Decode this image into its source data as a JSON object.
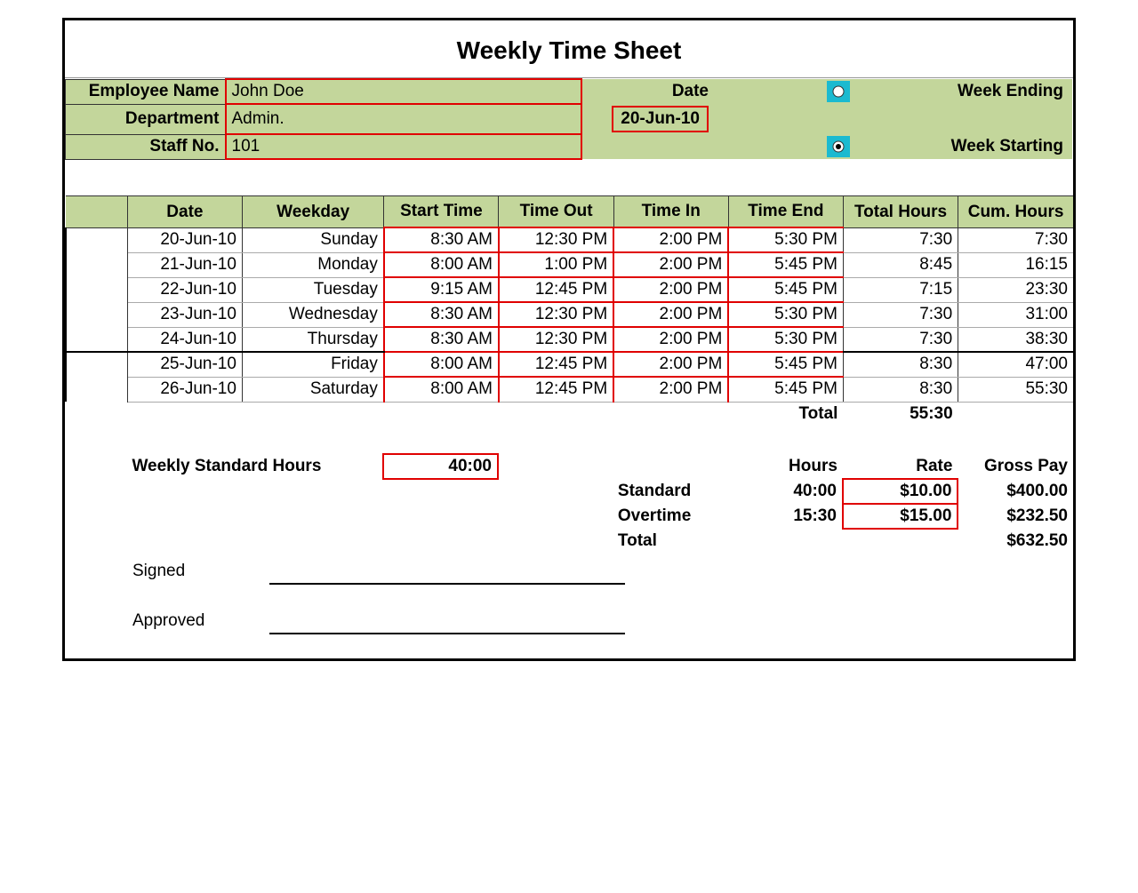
{
  "title": "Weekly Time Sheet",
  "labels": {
    "employee_name": "Employee Name",
    "department": "Department",
    "staff_no": "Staff No.",
    "date": "Date",
    "week_ending": "Week Ending",
    "week_starting": "Week Starting",
    "weekly_std_hours": "Weekly Standard Hours",
    "hours": "Hours",
    "rate": "Rate",
    "gross_pay": "Gross Pay",
    "standard": "Standard",
    "overtime": "Overtime",
    "total": "Total",
    "signed": "Signed",
    "approved": "Approved"
  },
  "employee": {
    "name": "John Doe",
    "department": "Admin.",
    "staff_no": "101",
    "date": "20-Jun-10"
  },
  "columns": {
    "date": "Date",
    "weekday": "Weekday",
    "start_time": "Start Time",
    "time_out": "Time Out",
    "time_in": "Time In",
    "time_end": "Time End",
    "total_hours": "Total Hours",
    "cum_hours": "Cum. Hours"
  },
  "rows": [
    {
      "date": "20-Jun-10",
      "weekday": "Sunday",
      "start": "8:30 AM",
      "out": "12:30 PM",
      "in": "2:00 PM",
      "end": "5:30 PM",
      "total": "7:30",
      "cum": "7:30"
    },
    {
      "date": "21-Jun-10",
      "weekday": "Monday",
      "start": "8:00 AM",
      "out": "1:00 PM",
      "in": "2:00 PM",
      "end": "5:45 PM",
      "total": "8:45",
      "cum": "16:15"
    },
    {
      "date": "22-Jun-10",
      "weekday": "Tuesday",
      "start": "9:15 AM",
      "out": "12:45 PM",
      "in": "2:00 PM",
      "end": "5:45 PM",
      "total": "7:15",
      "cum": "23:30"
    },
    {
      "date": "23-Jun-10",
      "weekday": "Wednesday",
      "start": "8:30 AM",
      "out": "12:30 PM",
      "in": "2:00 PM",
      "end": "5:30 PM",
      "total": "7:30",
      "cum": "31:00"
    },
    {
      "date": "24-Jun-10",
      "weekday": "Thursday",
      "start": "8:30 AM",
      "out": "12:30 PM",
      "in": "2:00 PM",
      "end": "5:30 PM",
      "total": "7:30",
      "cum": "38:30"
    },
    {
      "date": "25-Jun-10",
      "weekday": "Friday",
      "start": "8:00 AM",
      "out": "12:45 PM",
      "in": "2:00 PM",
      "end": "5:45 PM",
      "total": "8:30",
      "cum": "47:00"
    },
    {
      "date": "26-Jun-10",
      "weekday": "Saturday",
      "start": "8:00 AM",
      "out": "12:45 PM",
      "in": "2:00 PM",
      "end": "5:45 PM",
      "total": "8:30",
      "cum": "55:30"
    }
  ],
  "grand_total_hours": "55:30",
  "weekly_standard_hours": "40:00",
  "pay": {
    "standard": {
      "hours": "40:00",
      "rate": "$10.00",
      "gross": "$400.00"
    },
    "overtime": {
      "hours": "15:30",
      "rate": "$15.00",
      "gross": "$232.50"
    },
    "total_gross": "$632.50"
  }
}
